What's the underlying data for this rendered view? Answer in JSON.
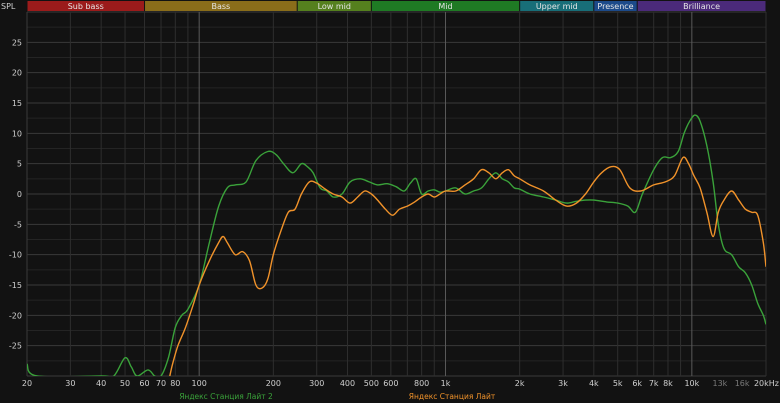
{
  "chart_data": {
    "type": "line",
    "ylabel": "SPL",
    "ylim": [
      -30,
      30
    ],
    "xlim": [
      20,
      20000
    ],
    "x_scale": "log",
    "grid": true,
    "legend_position": "bottom",
    "y_ticks": [
      {
        "value": 25,
        "label": "25"
      },
      {
        "value": 20,
        "label": "20"
      },
      {
        "value": 15,
        "label": "15"
      },
      {
        "value": 10,
        "label": "10"
      },
      {
        "value": 5,
        "label": "5"
      },
      {
        "value": 0,
        "label": "0"
      },
      {
        "value": -5,
        "label": "-5"
      },
      {
        "value": -10,
        "label": "-10"
      },
      {
        "value": -15,
        "label": "-15"
      },
      {
        "value": -20,
        "label": "-20"
      },
      {
        "value": -25,
        "label": "-25"
      }
    ],
    "x_ticks": [
      {
        "value": 20,
        "label": "20"
      },
      {
        "value": 30,
        "label": "30"
      },
      {
        "value": 40,
        "label": "40"
      },
      {
        "value": 50,
        "label": "50"
      },
      {
        "value": 60,
        "label": "60"
      },
      {
        "value": 70,
        "label": "70"
      },
      {
        "value": 80,
        "label": "80"
      },
      {
        "value": 100,
        "label": "100"
      },
      {
        "value": 200,
        "label": "200"
      },
      {
        "value": 300,
        "label": "300"
      },
      {
        "value": 400,
        "label": "400"
      },
      {
        "value": 500,
        "label": "500"
      },
      {
        "value": 600,
        "label": "600"
      },
      {
        "value": 800,
        "label": "800"
      },
      {
        "value": 1000,
        "label": "1k"
      },
      {
        "value": 2000,
        "label": "2k"
      },
      {
        "value": 3000,
        "label": "3k"
      },
      {
        "value": 4000,
        "label": "4k"
      },
      {
        "value": 5000,
        "label": "5k"
      },
      {
        "value": 6000,
        "label": "6k"
      },
      {
        "value": 7000,
        "label": "7k"
      },
      {
        "value": 8000,
        "label": "8k"
      },
      {
        "value": 10000,
        "label": "10k"
      },
      {
        "value": 13000,
        "label": "13k",
        "dim": true
      },
      {
        "value": 16000,
        "label": "16k",
        "dim": true
      },
      {
        "value": 20000,
        "label": "20kHz"
      }
    ],
    "bands": [
      {
        "name": "Sub bass",
        "from": 20,
        "to": 60,
        "color": "#9b1b1b"
      },
      {
        "name": "Bass",
        "from": 60,
        "to": 250,
        "color": "#8a6d1a"
      },
      {
        "name": "Low mid",
        "from": 250,
        "to": 500,
        "color": "#55801e"
      },
      {
        "name": "Mid",
        "from": 500,
        "to": 2000,
        "color": "#1f7a24"
      },
      {
        "name": "Upper mid",
        "from": 2000,
        "to": 4000,
        "color": "#186e78"
      },
      {
        "name": "Presence",
        "from": 4000,
        "to": 6000,
        "color": "#1c4a8a"
      },
      {
        "name": "Brilliance",
        "from": 6000,
        "to": 20000,
        "color": "#4b2a7a"
      }
    ],
    "series": [
      {
        "name": "Яндекс Станция Лайт 2",
        "color": "#3aa23a",
        "points": [
          [
            20,
            -28
          ],
          [
            22,
            -30
          ],
          [
            40,
            -30
          ],
          [
            45,
            -30
          ],
          [
            50,
            -27
          ],
          [
            53,
            -28.5
          ],
          [
            56,
            -30
          ],
          [
            62,
            -29
          ],
          [
            66,
            -30
          ],
          [
            70,
            -30
          ],
          [
            75,
            -27
          ],
          [
            80,
            -22
          ],
          [
            85,
            -20
          ],
          [
            90,
            -19
          ],
          [
            100,
            -15
          ],
          [
            110,
            -8
          ],
          [
            120,
            -2
          ],
          [
            130,
            1
          ],
          [
            140,
            1.5
          ],
          [
            155,
            2
          ],
          [
            170,
            5.5
          ],
          [
            190,
            7
          ],
          [
            205,
            6.5
          ],
          [
            220,
            5
          ],
          [
            240,
            3.5
          ],
          [
            260,
            5
          ],
          [
            275,
            4.5
          ],
          [
            290,
            3.5
          ],
          [
            310,
            1
          ],
          [
            330,
            0.5
          ],
          [
            350,
            -0.5
          ],
          [
            380,
            0
          ],
          [
            410,
            2
          ],
          [
            450,
            2.5
          ],
          [
            490,
            2
          ],
          [
            530,
            1.5
          ],
          [
            580,
            1.7
          ],
          [
            630,
            1.2
          ],
          [
            680,
            0.5
          ],
          [
            720,
            1.8
          ],
          [
            760,
            2.5
          ],
          [
            800,
            0
          ],
          [
            850,
            0.5
          ],
          [
            900,
            0.7
          ],
          [
            950,
            0.3
          ],
          [
            1000,
            0.5
          ],
          [
            1100,
            1
          ],
          [
            1200,
            0
          ],
          [
            1300,
            0.5
          ],
          [
            1400,
            1
          ],
          [
            1500,
            2.5
          ],
          [
            1600,
            3.5
          ],
          [
            1700,
            2.5
          ],
          [
            1800,
            2
          ],
          [
            1900,
            1
          ],
          [
            2000,
            0.8
          ],
          [
            2200,
            0
          ],
          [
            2500,
            -0.5
          ],
          [
            2800,
            -1
          ],
          [
            3100,
            -1.5
          ],
          [
            3400,
            -1.2
          ],
          [
            3700,
            -1
          ],
          [
            4000,
            -1
          ],
          [
            4500,
            -1.3
          ],
          [
            5000,
            -1.5
          ],
          [
            5500,
            -2
          ],
          [
            5900,
            -3
          ],
          [
            6300,
            0
          ],
          [
            7000,
            4
          ],
          [
            7600,
            6
          ],
          [
            8200,
            6
          ],
          [
            8800,
            7
          ],
          [
            9300,
            10
          ],
          [
            9800,
            12
          ],
          [
            10300,
            13
          ],
          [
            10800,
            12
          ],
          [
            11500,
            8
          ],
          [
            12200,
            2
          ],
          [
            12800,
            -5
          ],
          [
            13500,
            -9
          ],
          [
            14500,
            -10
          ],
          [
            15500,
            -12
          ],
          [
            16500,
            -13
          ],
          [
            17500,
            -15
          ],
          [
            18500,
            -18
          ],
          [
            19500,
            -20
          ],
          [
            20000,
            -21.5
          ]
        ]
      },
      {
        "name": "Яндекс Станция Лайт",
        "color": "#f0922a",
        "points": [
          [
            76,
            -30
          ],
          [
            78,
            -28
          ],
          [
            82,
            -25
          ],
          [
            88,
            -22
          ],
          [
            95,
            -18
          ],
          [
            100,
            -15
          ],
          [
            110,
            -11
          ],
          [
            120,
            -8
          ],
          [
            125,
            -7
          ],
          [
            130,
            -8
          ],
          [
            140,
            -10
          ],
          [
            150,
            -9.5
          ],
          [
            160,
            -11
          ],
          [
            170,
            -15
          ],
          [
            180,
            -15.5
          ],
          [
            190,
            -14
          ],
          [
            200,
            -10
          ],
          [
            215,
            -6
          ],
          [
            230,
            -3
          ],
          [
            245,
            -2.5
          ],
          [
            260,
            0
          ],
          [
            280,
            2
          ],
          [
            300,
            1.8
          ],
          [
            320,
            1
          ],
          [
            350,
            0
          ],
          [
            380,
            -0.5
          ],
          [
            410,
            -1.5
          ],
          [
            440,
            -0.5
          ],
          [
            470,
            0.5
          ],
          [
            500,
            0
          ],
          [
            530,
            -1
          ],
          [
            570,
            -2.5
          ],
          [
            610,
            -3.5
          ],
          [
            650,
            -2.5
          ],
          [
            700,
            -2
          ],
          [
            750,
            -1.3
          ],
          [
            800,
            -0.5
          ],
          [
            850,
            0
          ],
          [
            900,
            -0.5
          ],
          [
            950,
            0
          ],
          [
            1000,
            0.5
          ],
          [
            1100,
            0.5
          ],
          [
            1200,
            1.5
          ],
          [
            1300,
            2.5
          ],
          [
            1400,
            4
          ],
          [
            1500,
            3.5
          ],
          [
            1600,
            2.5
          ],
          [
            1700,
            3.5
          ],
          [
            1800,
            4
          ],
          [
            1900,
            3
          ],
          [
            2000,
            2.5
          ],
          [
            2200,
            1.5
          ],
          [
            2500,
            0.5
          ],
          [
            2800,
            -1
          ],
          [
            3100,
            -2
          ],
          [
            3400,
            -1.5
          ],
          [
            3700,
            0
          ],
          [
            4000,
            2
          ],
          [
            4300,
            3.5
          ],
          [
            4700,
            4.5
          ],
          [
            5100,
            4
          ],
          [
            5600,
            1
          ],
          [
            6200,
            0.5
          ],
          [
            7000,
            1.5
          ],
          [
            7800,
            2
          ],
          [
            8500,
            3
          ],
          [
            9200,
            6
          ],
          [
            9700,
            5
          ],
          [
            10200,
            3
          ],
          [
            10800,
            1
          ],
          [
            11500,
            -3
          ],
          [
            12200,
            -7
          ],
          [
            12800,
            -3
          ],
          [
            13500,
            -1
          ],
          [
            14500,
            0.5
          ],
          [
            15500,
            -1
          ],
          [
            16500,
            -2.5
          ],
          [
            17500,
            -3
          ],
          [
            18500,
            -3.5
          ],
          [
            19500,
            -8
          ],
          [
            20000,
            -12
          ]
        ]
      }
    ]
  }
}
